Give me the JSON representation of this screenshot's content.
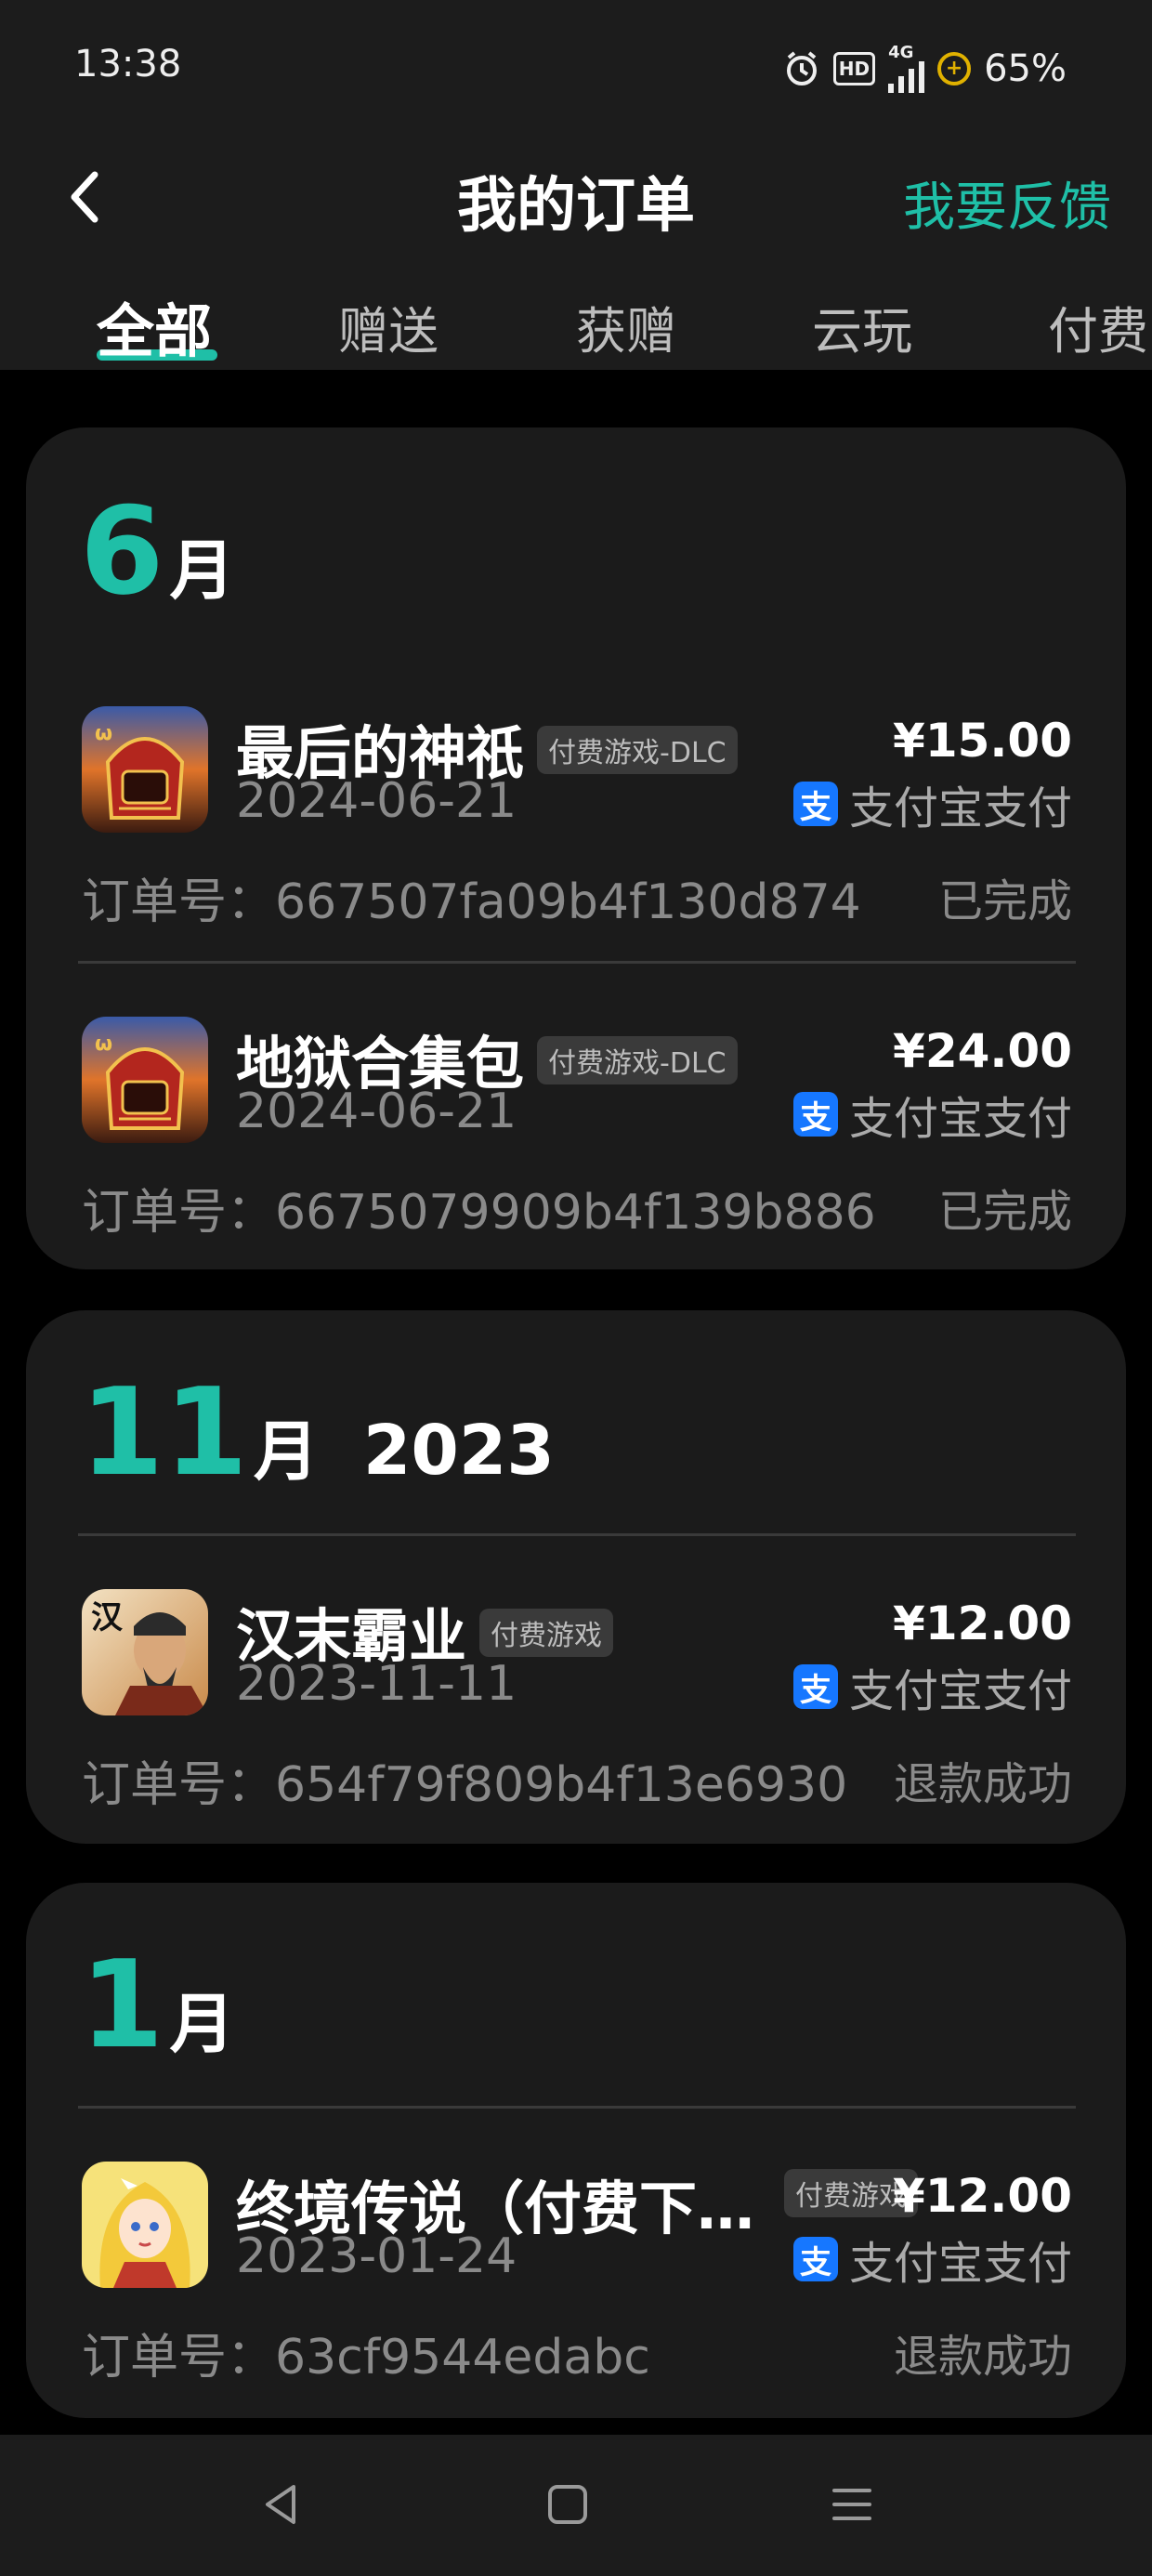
{
  "status_bar": {
    "time": "13:38",
    "network": "4G",
    "hd": "HD",
    "battery": "65%"
  },
  "header": {
    "title": "我的订单",
    "feedback": "我要反馈"
  },
  "tabs": [
    {
      "label": "全部",
      "active": true
    },
    {
      "label": "赠送"
    },
    {
      "label": "获赠"
    },
    {
      "label": "云玩"
    },
    {
      "label": "付费"
    }
  ],
  "groups": [
    {
      "month": "6",
      "unit": "月",
      "year": "",
      "orders": [
        {
          "name": "最后的神祇",
          "tag": "付费游戏-DLC",
          "date": "2024-06-21",
          "price": "¥15.00",
          "pay_icon": "支",
          "payment": "支付宝支付",
          "order_label": "订单号：",
          "order_no": "667507fa09b4f130d874",
          "status": "已完成",
          "icon": "knight-helmet-icon"
        },
        {
          "name": "地狱合集包",
          "tag": "付费游戏-DLC",
          "date": "2024-06-21",
          "price": "¥24.00",
          "pay_icon": "支",
          "payment": "支付宝支付",
          "order_label": "订单号：",
          "order_no": "6675079909b4f139b886",
          "status": "已完成",
          "icon": "knight-helmet-icon"
        }
      ]
    },
    {
      "month": "11",
      "unit": "月",
      "year": "2023",
      "orders": [
        {
          "name": "汉末霸业",
          "tag": "付费游戏",
          "date": "2023-11-11",
          "price": "¥12.00",
          "pay_icon": "支",
          "payment": "支付宝支付",
          "order_label": "订单号：",
          "order_no": "654f79f809b4f13e6930",
          "status": "退款成功",
          "icon": "warlord-portrait-icon",
          "icon_char": "汉"
        }
      ]
    },
    {
      "month": "1",
      "unit": "月",
      "year": "",
      "orders": [
        {
          "name": "终境传说（付费下…",
          "tag": "付费游戏",
          "date": "2023-01-24",
          "price": "¥12.00",
          "pay_icon": "支",
          "payment": "支付宝支付",
          "order_label": "订单号：",
          "order_no": "63cf9544edabc",
          "status": "退款成功",
          "icon": "anime-girl-icon"
        }
      ]
    }
  ],
  "colors": {
    "accent": "#1fbfa7",
    "background": "#000000",
    "card": "#1b1b1b",
    "alipay": "#1677ff"
  }
}
